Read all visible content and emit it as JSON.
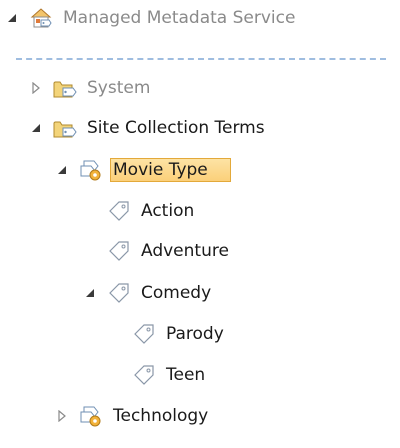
{
  "tree": {
    "root": {
      "label": "Managed Metadata Service",
      "expanded": true
    },
    "groups": [
      {
        "label": "System",
        "expanded": false
      },
      {
        "label": "Site Collection Terms",
        "expanded": true
      }
    ],
    "term_sets": [
      {
        "label": "Movie Type",
        "expanded": true,
        "selected": true
      },
      {
        "label": "Technology",
        "expanded": false
      }
    ],
    "terms": [
      {
        "label": "Action"
      },
      {
        "label": "Adventure"
      },
      {
        "label": "Comedy",
        "expanded": true
      }
    ],
    "child_terms": [
      {
        "label": "Parody"
      },
      {
        "label": "Teen"
      }
    ]
  },
  "colors": {
    "divider": "#9fbde0",
    "selection_fill": "#fbd07a",
    "selection_border": "#e3a93a",
    "muted_text": "#8a8a8a"
  }
}
